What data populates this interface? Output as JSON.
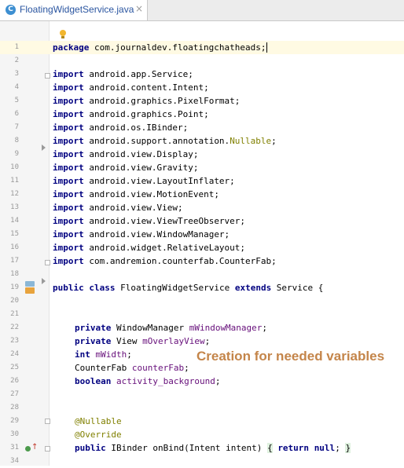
{
  "tab": {
    "icon_letter": "C",
    "filename": "FloatingWidgetService.java",
    "close": "×"
  },
  "line_numbers": [
    "1",
    "2",
    "3",
    "4",
    "5",
    "6",
    "7",
    "8",
    "9",
    "10",
    "11",
    "12",
    "13",
    "14",
    "15",
    "16",
    "17",
    "18",
    "19",
    "20",
    "21",
    "22",
    "23",
    "24",
    "25",
    "26",
    "27",
    "28",
    "29",
    "30",
    "31",
    "34"
  ],
  "code": {
    "l1": {
      "kw": "package",
      "rest": " com.journaldev.floatingchatheads;"
    },
    "imports": [
      " android.app.Service;",
      " android.content.Intent;",
      " android.graphics.PixelFormat;",
      " android.graphics.Point;",
      " android.os.IBinder;",
      " android.support.annotation.",
      " android.view.Display;",
      " android.view.Gravity;",
      " android.view.LayoutInflater;",
      " android.view.MotionEvent;",
      " android.view.View;",
      " android.view.ViewTreeObserver;",
      " android.view.WindowManager;",
      " android.widget.RelativeLayout;",
      " com.andremion.counterfab.CounterFab;"
    ],
    "import_kw": "import",
    "nullable_import": "Nullable",
    "l19": {
      "kw1": "public",
      "kw2": "class",
      "name": " FloatingWidgetService ",
      "kw3": "extends",
      "rest": " Service {"
    },
    "l22": {
      "kw": "private",
      "type": " WindowManager ",
      "field": "mWindowManager",
      "end": ";"
    },
    "l23": {
      "kw": "private",
      "type": " View ",
      "field": "mOverlayView",
      "end": ";"
    },
    "l24": {
      "kw": "int",
      "field": " mWidth",
      "end": ";"
    },
    "l25": {
      "type": "CounterFab ",
      "field": "counterFab",
      "end": ";"
    },
    "l26": {
      "kw": "boolean",
      "field": " activity_background",
      "end": ";"
    },
    "l29": "@Nullable",
    "l30": "@Override",
    "l31": {
      "kw": "public",
      "sig": " IBinder onBind(Intent intent) ",
      "open": "{",
      "kw2": "return",
      "kw3": "null",
      "end": ";",
      "close": "}"
    }
  },
  "annotation_caption": "Creation for needed variables",
  "colors": {
    "keyword": "#000080",
    "annotation": "#808000",
    "field": "#660e7a",
    "caption": "#c4854a"
  }
}
